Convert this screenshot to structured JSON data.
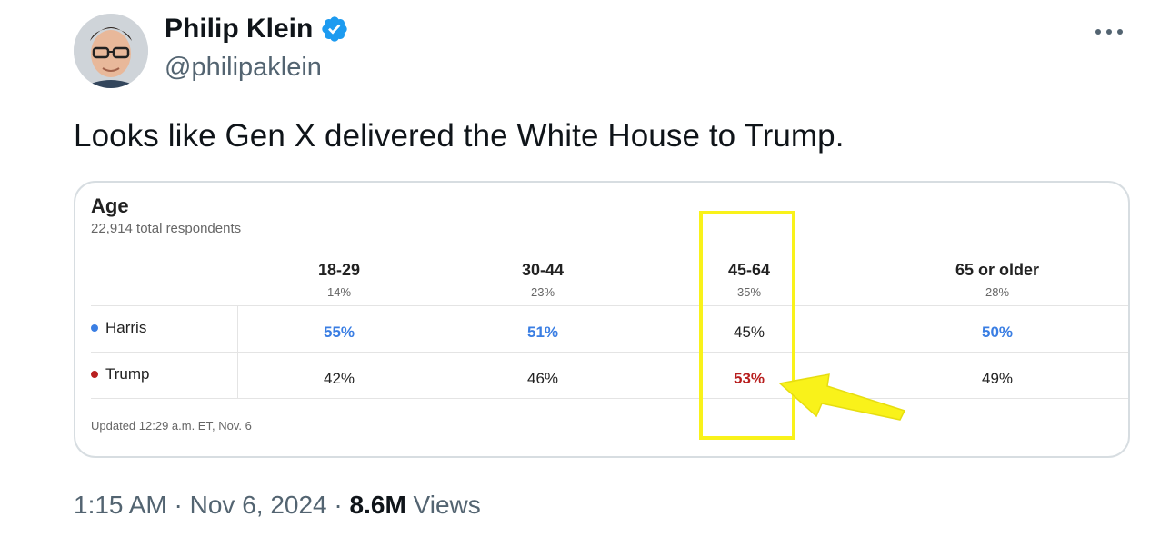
{
  "tweet": {
    "display_name": "Philip Klein",
    "handle": "@philipaklein",
    "text": "Looks like Gen X delivered the White House to Trump.",
    "time": "1:15 AM",
    "date": "Nov 6, 2024",
    "views_count": "8.6M",
    "views_label": "Views",
    "separator": "·"
  },
  "card": {
    "title": "Age",
    "subtitle": "22,914 total respondents",
    "columns": [
      {
        "label": "18-29",
        "share": "14%"
      },
      {
        "label": "30-44",
        "share": "23%"
      },
      {
        "label": "45-64",
        "share": "35%"
      },
      {
        "label": "65 or older",
        "share": "28%"
      }
    ],
    "rows": [
      {
        "name": "Harris",
        "values": [
          "55%",
          "51%",
          "45%",
          "50%"
        ]
      },
      {
        "name": "Trump",
        "values": [
          "42%",
          "46%",
          "53%",
          "49%"
        ]
      }
    ],
    "updated": "Updated 12:29 a.m. ET, Nov. 6"
  },
  "colors": {
    "harris": "#3a7ee3",
    "trump": "#b81f1f",
    "highlight": "#f9f21a",
    "verified": "#1d9bf0"
  }
}
